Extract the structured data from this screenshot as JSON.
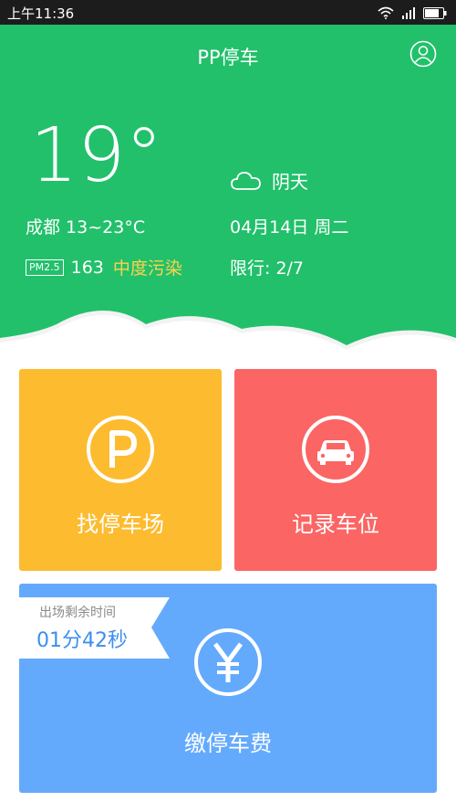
{
  "status_bar": {
    "time": "上午11:36"
  },
  "header": {
    "title": "PP停车"
  },
  "weather": {
    "temperature": "19°",
    "condition": "阴天",
    "city_range": "成都 13~23°C",
    "date": "04月14日 周二",
    "pm_label": "PM2.5",
    "aqi_value": "163",
    "aqi_level": "中度污染",
    "traffic_limit": "限行: 2/7"
  },
  "actions": {
    "find_label": "找停车场",
    "record_label": "记录车位",
    "pay_label": "缴停车费"
  },
  "timer": {
    "caption": "出场剩余时间",
    "value": "01分42秒"
  },
  "colors": {
    "header_green": "#22c06b",
    "find_yellow": "#fdbb2f",
    "record_red": "#fb6563",
    "pay_blue": "#64aafc",
    "aqi_yellow": "#ffd24a",
    "timer_blue": "#3b8ef0"
  },
  "icons": {
    "status": [
      "wifi-icon",
      "signal-icon",
      "battery-icon"
    ],
    "profile": "user-icon",
    "weather": "cloud-icon",
    "find": "parking-icon",
    "record": "car-icon",
    "pay": "yen-icon"
  }
}
